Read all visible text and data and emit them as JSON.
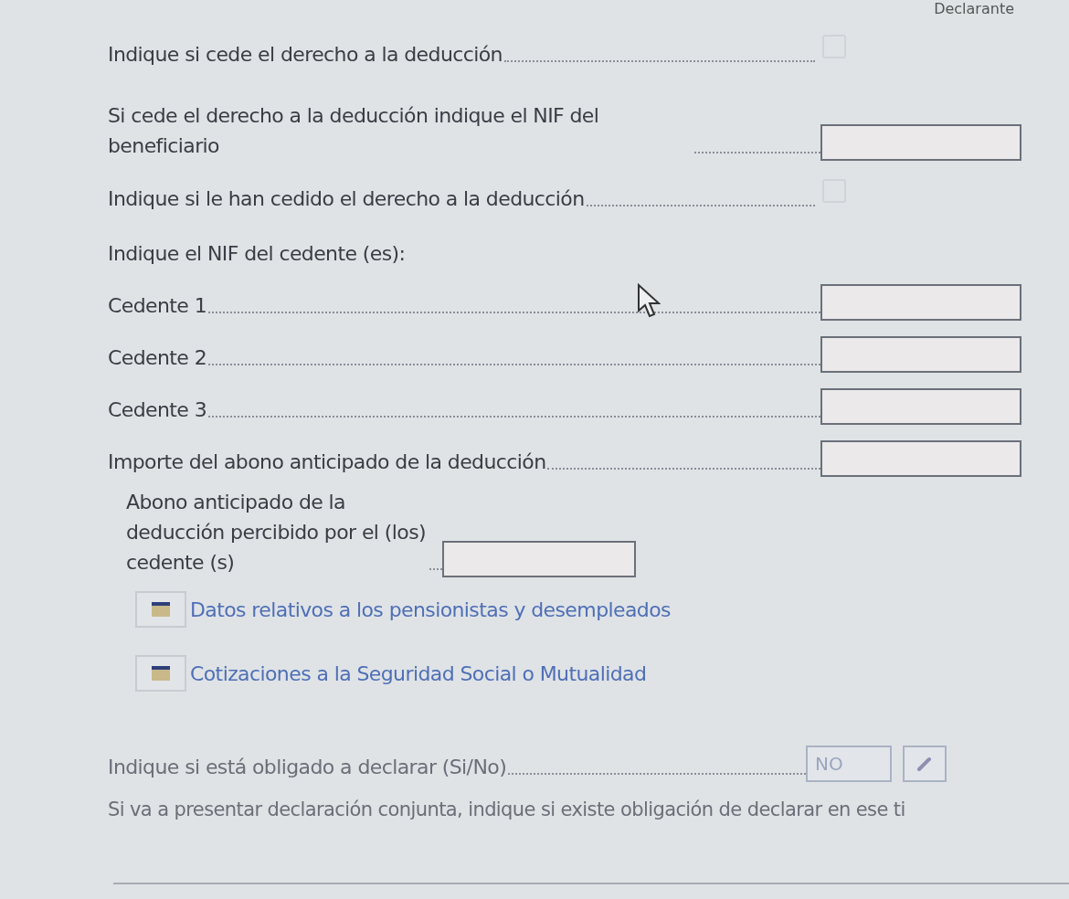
{
  "header": {
    "title": "Declarante"
  },
  "rows": [
    {
      "kind": "checkbox",
      "label": "Indique si cede el derecho a la deducción",
      "checked": false,
      "disabled": true
    },
    {
      "kind": "text",
      "label": "Si cede el derecho a la deducción indique el NIF del beneficiario",
      "value": ""
    },
    {
      "kind": "checkbox",
      "label": "Indique si le han cedido el derecho a la deducción",
      "checked": false,
      "disabled": true
    },
    {
      "kind": "heading",
      "label": "Indique el NIF del cedente (es):"
    },
    {
      "kind": "text",
      "label": "Cedente 1",
      "value": ""
    },
    {
      "kind": "text",
      "label": "Cedente 2",
      "value": ""
    },
    {
      "kind": "text",
      "label": "Cedente 3",
      "value": ""
    },
    {
      "kind": "text",
      "label": "Importe del abono anticipado de la deducción",
      "value": ""
    },
    {
      "kind": "narrow",
      "label": "Abono anticipado de la deducción percibido por el (los) cedente (s)",
      "value": ""
    },
    {
      "kind": "link",
      "label": "Datos relativos a los pensionistas y desempleados"
    },
    {
      "kind": "link",
      "label": "Cotizaciones a la Seguridad Social o Mutualidad"
    },
    {
      "kind": "edit",
      "label": "Indique si está obligado a declarar (Si/No)",
      "value": "NO",
      "disabled": true
    },
    {
      "kind": "note",
      "label": "Si va a presentar declaración conjunta, indique si existe obligación de declarar en ese ti"
    }
  ]
}
